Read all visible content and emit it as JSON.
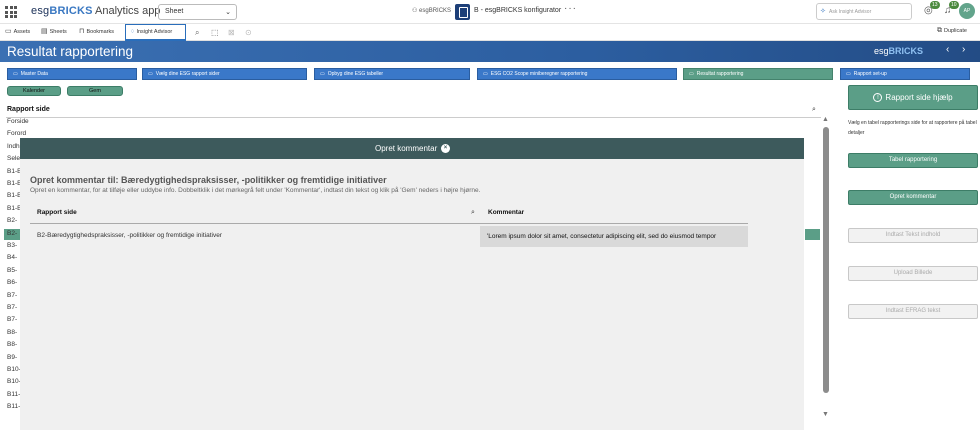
{
  "topbar": {
    "logo_prefix": "esg",
    "logo_suffix": "BRICKS",
    "app_label": "Analytics app",
    "sheet_select": "Sheet",
    "space_name": "esgBRICKS",
    "app_name": "B - esgBRICKS konfigurator",
    "more": "···",
    "insight_placeholder": "Ask Insight Advisor",
    "notif_count_1": "13",
    "notif_count_2": "10",
    "avatar_initials": "AP"
  },
  "toolbar": {
    "assets": "Assets",
    "sheets": "Sheets",
    "bookmarks": "Bookmarks",
    "insight_advisor": "Insight Advisor",
    "duplicate": "Duplicate"
  },
  "header": {
    "title": "Resultat rapportering",
    "logo_prefix": "esg",
    "logo_suffix": "BRICKS",
    "prev": "‹",
    "next": "›"
  },
  "nav_buttons": [
    {
      "label": "Master Data"
    },
    {
      "label": "Vælg dine ESG rapport sider"
    },
    {
      "label": "Opbyg dine ESG tabeller"
    },
    {
      "label": "ESG CO2 Scope miniberegner rapportering"
    },
    {
      "label": "Resultat rapportering"
    },
    {
      "label": "Rapport set-up"
    }
  ],
  "actions": {
    "calendar": "Kalender",
    "save": "Gem"
  },
  "list": {
    "header": "Rapport side",
    "rows": [
      "Forside",
      "Forord",
      "Indh",
      "Sele",
      "B1-B",
      "B1-B",
      "B1-B",
      "B1-B",
      "B2-",
      "B2-",
      "B3-",
      "B4-",
      "B5-",
      "B6-",
      "B7-",
      "B7-",
      "B7-",
      "B8-",
      "B8-",
      "B9-",
      "B10-",
      "B10-",
      "B11-",
      "B11-"
    ]
  },
  "modal": {
    "title": "Opret kommentar",
    "close": "×",
    "heading": "Opret kommentar til: Bæredygtighedspraksisser, -politikker og fremtidige initiativer",
    "subtitle": "Opret en kommentar, for at tilføje eller uddybe info. Dobbeltklik i det mørkegrå felt under 'Kommentar', indtast din tekst og klik på 'Gem' neders i højre hjørne.",
    "col1": "Rapport side",
    "col2": "Kommentar",
    "row_page": "B2-Bæredygtighedspraksisser, -politikker og fremtidige initiativer",
    "row_comment": "'Lorem ipsum dolor sit amet, consectetur adipiscing elit, sed do eiusmod tempor"
  },
  "right_panel": {
    "help_button": "Rapport side hjælp",
    "help_text": "Vælg en tabel rapporterings side for at rapportere på tabel detaljer",
    "buttons": [
      {
        "label": "Tabel rapportering",
        "enabled": true
      },
      {
        "label": "Opret kommentar",
        "enabled": true
      },
      {
        "label": "Indtast Tekst indhold",
        "enabled": false
      },
      {
        "label": "Upload Billede",
        "enabled": false
      },
      {
        "label": "Indtast EFRAG tekst",
        "enabled": false
      }
    ]
  },
  "colors": {
    "header_blue": "#2c5ea0",
    "nav_blue": "#3a78c9",
    "accent_green": "#5b9e87",
    "modal_bar": "#3d5a5c"
  }
}
